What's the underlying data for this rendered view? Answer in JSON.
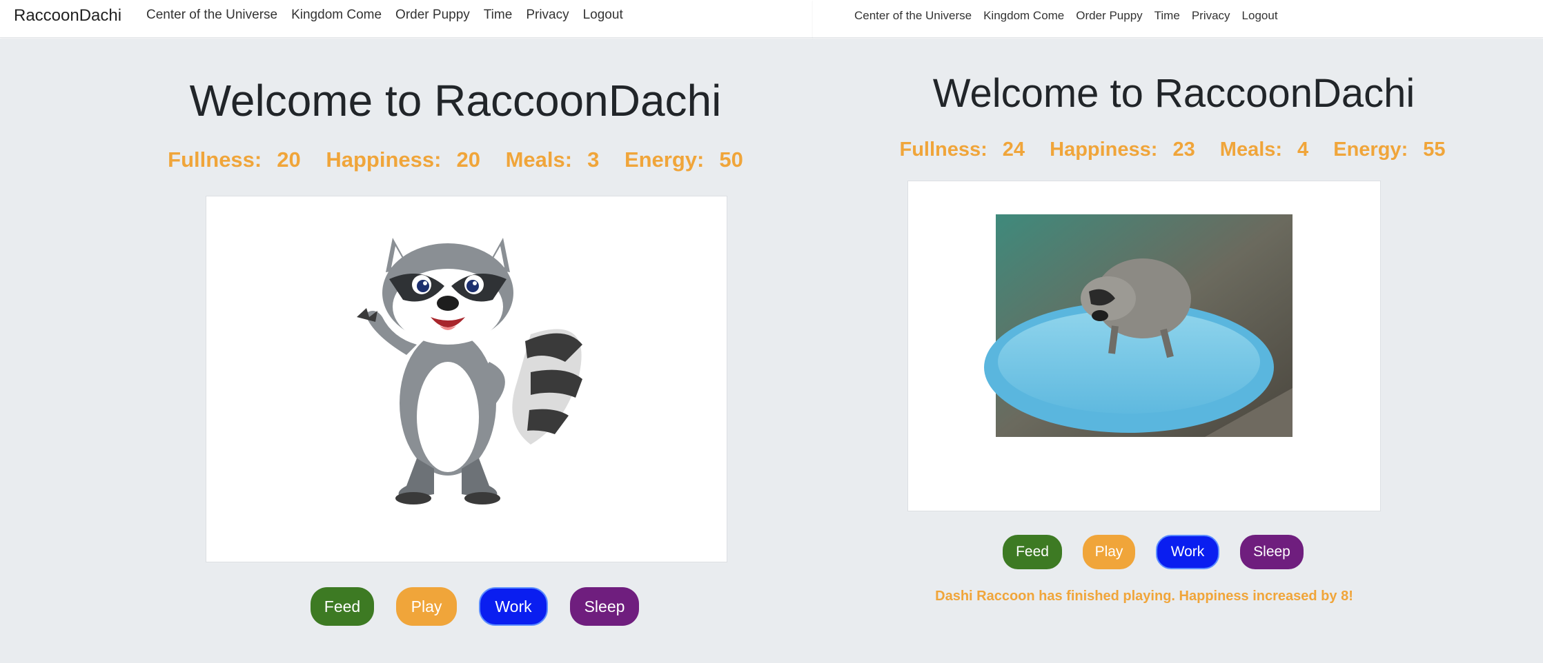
{
  "left": {
    "navbar": {
      "brand": "RaccoonDachi",
      "links": [
        "Center of the Universe",
        "Kingdom Come",
        "Order Puppy",
        "Time",
        "Privacy",
        "Logout"
      ]
    },
    "title": "Welcome to RaccoonDachi",
    "stats": [
      {
        "label": "Fullness:",
        "value": "20"
      },
      {
        "label": "Happiness:",
        "value": "20"
      },
      {
        "label": "Meals:",
        "value": "3"
      },
      {
        "label": "Energy:",
        "value": "50"
      }
    ],
    "buttons": {
      "feed": "Feed",
      "play": "Play",
      "work": "Work",
      "sleep": "Sleep"
    }
  },
  "right": {
    "navbar": {
      "links": [
        "Center of the Universe",
        "Kingdom Come",
        "Order Puppy",
        "Time",
        "Privacy",
        "Logout"
      ]
    },
    "title": "Welcome to RaccoonDachi",
    "stats": [
      {
        "label": "Fullness:",
        "value": "24"
      },
      {
        "label": "Happiness:",
        "value": "23"
      },
      {
        "label": "Meals:",
        "value": "4"
      },
      {
        "label": "Energy:",
        "value": "55"
      }
    ],
    "buttons": {
      "feed": "Feed",
      "play": "Play",
      "work": "Work",
      "sleep": "Sleep"
    },
    "message": "Dashi Raccoon has finished playing. Happiness increased by 8!"
  },
  "colors": {
    "accent_orange": "#f0a53a",
    "feed_green": "#3d7a23",
    "work_blue": "#0a1ef0",
    "sleep_purple": "#6f1e7e",
    "page_bg": "#e9ecef"
  }
}
